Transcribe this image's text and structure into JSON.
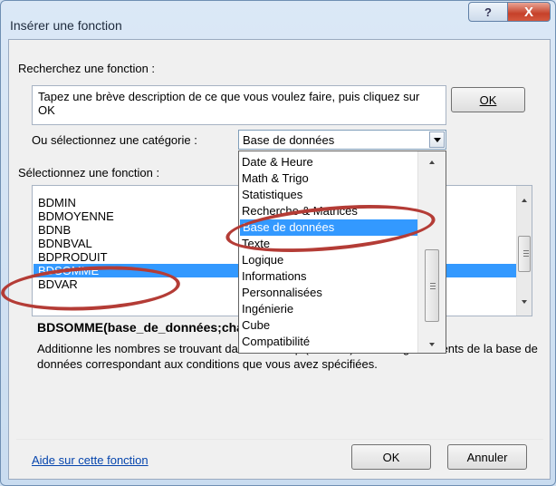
{
  "dialog": {
    "title": "Insérer une fonction",
    "help_glyph": "?",
    "close_glyph": "X"
  },
  "search": {
    "label": "Recherchez une fonction :",
    "description": "Tapez une brève description de ce que vous voulez faire, puis cliquez sur OK",
    "ok_label": "OK"
  },
  "category": {
    "label": "Ou sélectionnez une catégorie :",
    "selected": "Base de données",
    "options": [
      "Date & Heure",
      "Math & Trigo",
      "Statistiques",
      "Recherche & Matrices",
      "Base de données",
      "Texte",
      "Logique",
      "Informations",
      "Personnalisées",
      "Ingénierie",
      "Cube",
      "Compatibilité"
    ]
  },
  "functions": {
    "label": "Sélectionnez une fonction :",
    "items": [
      "BDMIN",
      "BDMOYENNE",
      "BDNB",
      "BDNBVAL",
      "BDPRODUIT",
      "BDSOMME",
      "BDVAR"
    ],
    "selected": "BDSOMME"
  },
  "details": {
    "syntax": "BDSOMME(base_de_données;champ;critères)",
    "description": "Additionne les nombres se trouvant dans le champ (colonne) des enregistrements de la base de données correspondant aux conditions que vous avez spécifiées."
  },
  "footer": {
    "help_link": "Aide sur cette fonction",
    "ok_label": "OK",
    "cancel_label": "Annuler"
  },
  "colors": {
    "selection": "#3399ff",
    "annotation": "#b43c36",
    "link": "#0645ad"
  }
}
